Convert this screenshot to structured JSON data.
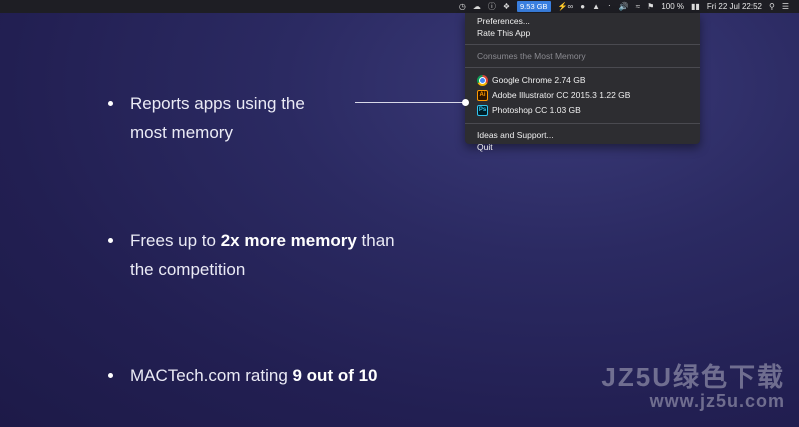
{
  "menubar": {
    "memory_label": "9.53 GB",
    "battery_percent": "100 %",
    "datetime": "Fri 22 Jul  22:52",
    "icons": [
      "clock-icon",
      "creative-cloud-icon",
      "info-icon",
      "dropbox-icon",
      "memory-monitor-icon",
      "bolt-icon",
      "infinity-icon",
      "ball-icon",
      "upload-icon",
      "bluetooth-icon",
      "volume-icon",
      "wifi-icon",
      "flag-icon",
      "battery-icon",
      "search-icon",
      "list-icon"
    ]
  },
  "dropdown": {
    "preferences": "Preferences...",
    "rate": "Rate This App",
    "section_header": "Consumes the Most Memory",
    "apps": [
      {
        "name": "Google Chrome 2.74 GB",
        "icon": "chrome-icon"
      },
      {
        "name": "Adobe Illustrator CC 2015.3 1.22 GB",
        "icon": "illustrator-icon"
      },
      {
        "name": "Photoshop CC 1.03 GB",
        "icon": "photoshop-icon"
      }
    ],
    "ideas": "Ideas and Support...",
    "quit": "Quit"
  },
  "bullets": {
    "b1_line1": "Reports apps using the",
    "b1_line2": "most memory",
    "b2_pre": "Frees up to ",
    "b2_bold": "2x more memory",
    "b2_post": " than",
    "b2_line2": "the competition",
    "b3_pre": "MACTech.com rating ",
    "b3_bold": "9 out of 10"
  },
  "watermark": {
    "line1": "JZ5U绿色下载",
    "line2": "www.jz5u.com"
  }
}
